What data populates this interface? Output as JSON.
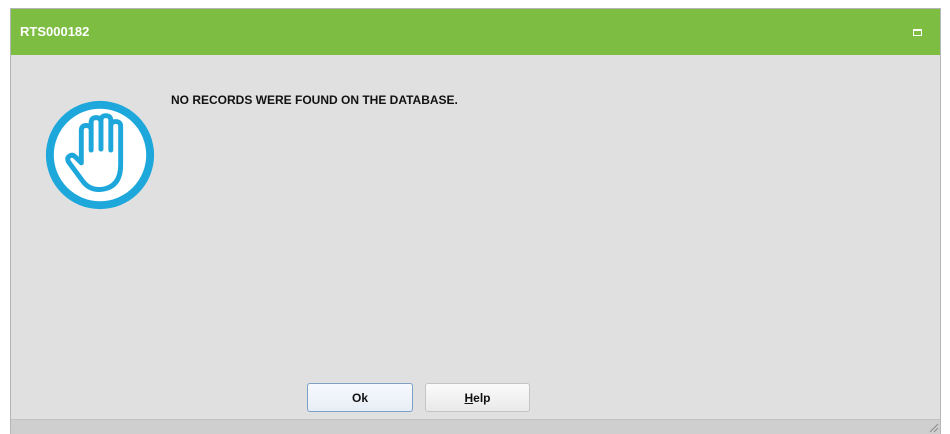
{
  "window": {
    "title": "RTS000182"
  },
  "message": {
    "text": "NO RECORDS WERE FOUND ON THE DATABASE.",
    "icon": "stop-hand-icon"
  },
  "buttons": {
    "ok_label": "Ok",
    "help_label_first": "H",
    "help_label_rest": "elp"
  },
  "colors": {
    "titlebar": "#7cbd42",
    "dialog_background": "#e0e0e0",
    "icon_accent": "#1ea7db"
  }
}
